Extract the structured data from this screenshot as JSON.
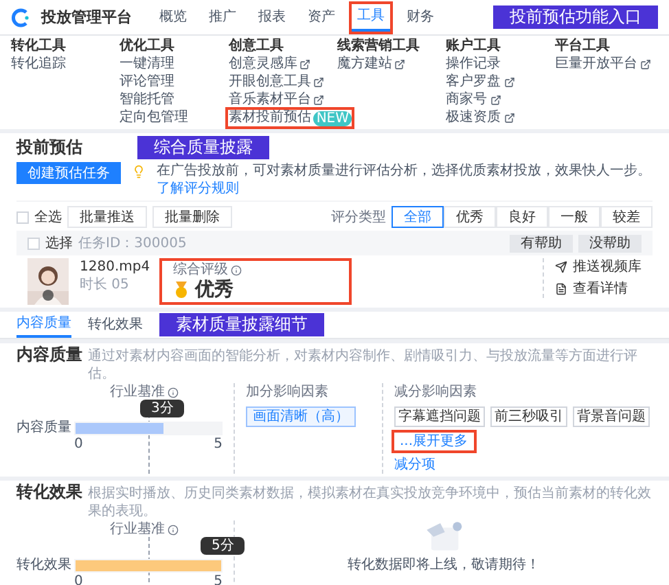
{
  "header": {
    "title": "投放管理平台",
    "annotation": "投前预估功能入口",
    "nav": [
      {
        "label": "概览",
        "selected": false,
        "highlighted": false
      },
      {
        "label": "推广",
        "selected": false,
        "highlighted": false
      },
      {
        "label": "报表",
        "selected": false,
        "highlighted": false
      },
      {
        "label": "资产",
        "selected": false,
        "highlighted": false
      },
      {
        "label": "工具",
        "selected": true,
        "highlighted": true
      },
      {
        "label": "财务",
        "selected": false,
        "highlighted": false
      }
    ]
  },
  "menu": {
    "columns": [
      {
        "title": "转化工具",
        "items": [
          {
            "label": "转化追踪",
            "external": false,
            "highlighted": false
          }
        ]
      },
      {
        "title": "优化工具",
        "items": [
          {
            "label": "一键清理",
            "external": false,
            "highlighted": false
          },
          {
            "label": "评论管理",
            "external": false,
            "highlighted": false
          },
          {
            "label": "智能托管",
            "external": false,
            "highlighted": false
          },
          {
            "label": "定向包管理",
            "external": false,
            "highlighted": false
          }
        ]
      },
      {
        "title": "创意工具",
        "items": [
          {
            "label": "创意灵感库",
            "external": true,
            "highlighted": false
          },
          {
            "label": "开眼创意工具",
            "external": true,
            "highlighted": false
          },
          {
            "label": "音乐素材平台",
            "external": true,
            "highlighted": false
          },
          {
            "label": "素材投前预估",
            "badge": "NEW",
            "external": false,
            "highlighted": true
          }
        ]
      },
      {
        "title": "线索营销工具",
        "items": [
          {
            "label": "魔方建站",
            "external": true,
            "highlighted": false
          }
        ]
      },
      {
        "title": "账户工具",
        "items": [
          {
            "label": "操作记录",
            "external": false,
            "highlighted": false
          },
          {
            "label": "客户罗盘",
            "external": true,
            "highlighted": false
          },
          {
            "label": "商家号",
            "external": true,
            "highlighted": false
          },
          {
            "label": "极速资质",
            "external": true,
            "highlighted": false
          }
        ]
      },
      {
        "title": "平台工具",
        "items": [
          {
            "label": "巨量开放平台",
            "external": true,
            "highlighted": false
          }
        ]
      }
    ]
  },
  "estimate": {
    "title": "投前预估",
    "annotation": "综合质量披露",
    "create_button": "创建预估任务",
    "tip": "在广告投放前，可对素材质量进行评估分析，选择优质素材投放，效果快人一步。",
    "tip_link": "了解评分规则",
    "select_all": "全选",
    "select_all_checked": false,
    "batch_buttons": [
      "批量推送",
      "批量删除"
    ],
    "filter_label": "评分类型",
    "filters": [
      {
        "label": "全部",
        "selected": true
      },
      {
        "label": "优秀",
        "selected": false
      },
      {
        "label": "良好",
        "selected": false
      },
      {
        "label": "一般",
        "selected": false
      },
      {
        "label": "较差",
        "selected": false
      }
    ],
    "task": {
      "select": "选择",
      "checked": false,
      "task_id": "任务ID：300005",
      "feedback": [
        "有帮助",
        "没帮助"
      ],
      "file_name": "1280.mp4",
      "duration": "时长 05",
      "rating_label": "综合评级",
      "rating": "优秀",
      "highlighted": true,
      "actions": [
        {
          "kind": "send",
          "label": "推送视频库"
        },
        {
          "kind": "detail",
          "label": "查看详情"
        }
      ]
    }
  },
  "details": {
    "annotation": "素材质量披露细节",
    "tabs": [
      {
        "label": "内容质量",
        "selected": true
      },
      {
        "label": "转化效果",
        "selected": false
      }
    ],
    "content": {
      "title": "内容质量",
      "description": "通过对素材内容画面的智能分析，对素材内容制作、剧情吸引力、与投放流量等方面进行评估。",
      "meter": {
        "label": "内容质量",
        "benchmark": "行业基准",
        "tooltip": "3分",
        "level": 0.6,
        "min": "0",
        "max": "5"
      },
      "plus_title": "加分影响因素",
      "plus_tags": [
        "画面清晰（高）"
      ],
      "minus_title": "减分影响因素",
      "minus_tags": [
        "字幕遮挡问题",
        "前三秒吸引",
        "背景音问题"
      ],
      "more": "...展开更多",
      "more_highlighted": true,
      "minus_link": "减分项"
    },
    "conversion": {
      "title": "转化效果",
      "description": "根据实时播放、历史同类素材数据，模拟素材在真实投放竞争环境中，预估当前素材的转化效果的表现。",
      "meter": {
        "label": "转化效果",
        "benchmark": "行业基准",
        "tooltip": "5分",
        "level": 1,
        "min": "0",
        "max": "5"
      },
      "empty_text": "转化数据即将上线，敬请期待！"
    }
  }
}
